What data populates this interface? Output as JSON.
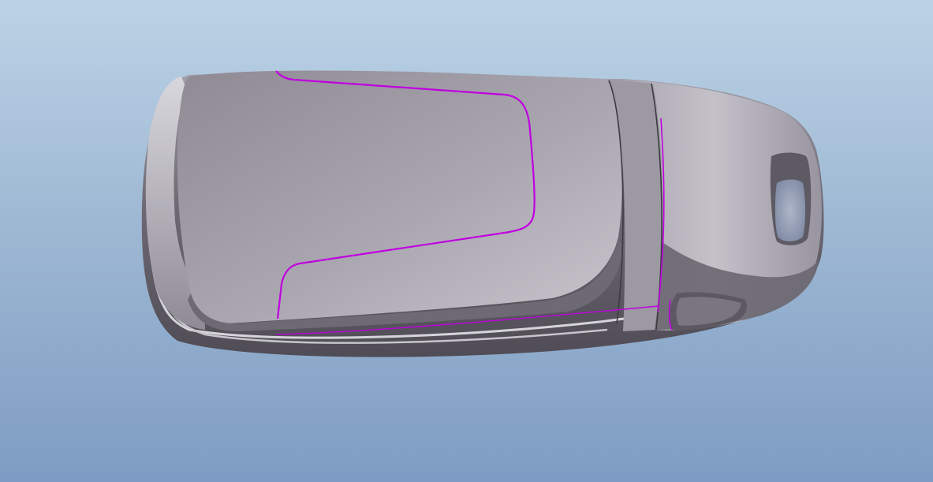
{
  "scene": {
    "background_top": "#bcd3e6",
    "background_bottom": "#7e9cc3",
    "model": {
      "name": "key-fob-shell",
      "body_color": "#9e9aa3",
      "highlight_color": "#d2d0d7",
      "shadow_color": "#5b5861",
      "edge_highlight_color": "#c000e0"
    }
  }
}
